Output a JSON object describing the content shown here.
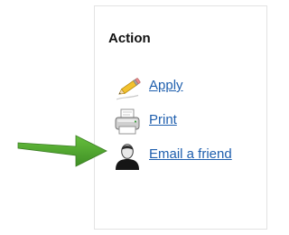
{
  "panel": {
    "heading": "Action",
    "items": [
      {
        "label": "Apply",
        "icon": "pencil-icon"
      },
      {
        "label": "Print",
        "icon": "printer-icon"
      },
      {
        "label": "Email a friend",
        "icon": "person-icon"
      }
    ]
  },
  "annotation": {
    "icon": "green-arrow-icon",
    "color": "#4ea72e"
  },
  "colors": {
    "link": "#1f5fae",
    "heading": "#111111",
    "panel_border": "#e3e3e3"
  }
}
